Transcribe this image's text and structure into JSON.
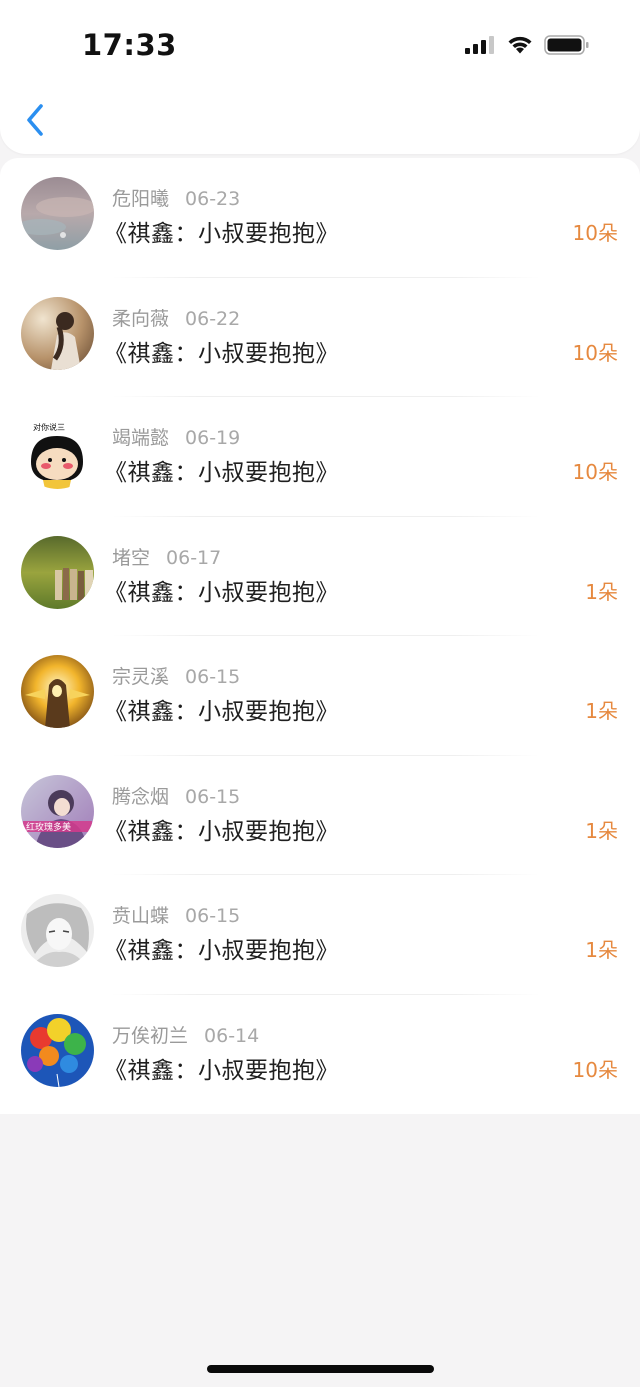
{
  "status_bar": {
    "time": "17:33"
  },
  "header": {
    "back_icon": "chevron-left-icon"
  },
  "colors": {
    "accent_blue": "#2b8ff0",
    "amount_orange": "#e6893f"
  },
  "items": [
    {
      "user": "危阳曦",
      "date": "06-23",
      "title": "《祺鑫：小叔要抱抱》",
      "amount": "10朵",
      "avatar": "sunset-sky"
    },
    {
      "user": "柔向薇",
      "date": "06-22",
      "title": "《祺鑫：小叔要抱抱》",
      "amount": "10朵",
      "avatar": "girl-in-field"
    },
    {
      "user": "竭端懿",
      "date": "06-19",
      "title": "《祺鑫：小叔要抱抱》",
      "amount": "10朵",
      "avatar": "cartoon-face",
      "avatar_text": "对你说三"
    },
    {
      "user": "堵空",
      "date": "06-17",
      "title": "《祺鑫：小叔要抱抱》",
      "amount": "1朵",
      "avatar": "books-in-grass"
    },
    {
      "user": "宗灵溪",
      "date": "06-15",
      "title": "《祺鑫：小叔要抱抱》",
      "amount": "1朵",
      "avatar": "golden-hero"
    },
    {
      "user": "腾念烟",
      "date": "06-15",
      "title": "《祺鑫：小叔要抱抱》",
      "amount": "1朵",
      "avatar": "girl-with-caption",
      "avatar_text": "红玫瑰多美"
    },
    {
      "user": "贲山蝶",
      "date": "06-15",
      "title": "《祺鑫：小叔要抱抱》",
      "amount": "1朵",
      "avatar": "sketch-portrait"
    },
    {
      "user": "万俟初兰",
      "date": "06-14",
      "title": "《祺鑫：小叔要抱抱》",
      "amount": "10朵",
      "avatar": "balloons"
    }
  ]
}
